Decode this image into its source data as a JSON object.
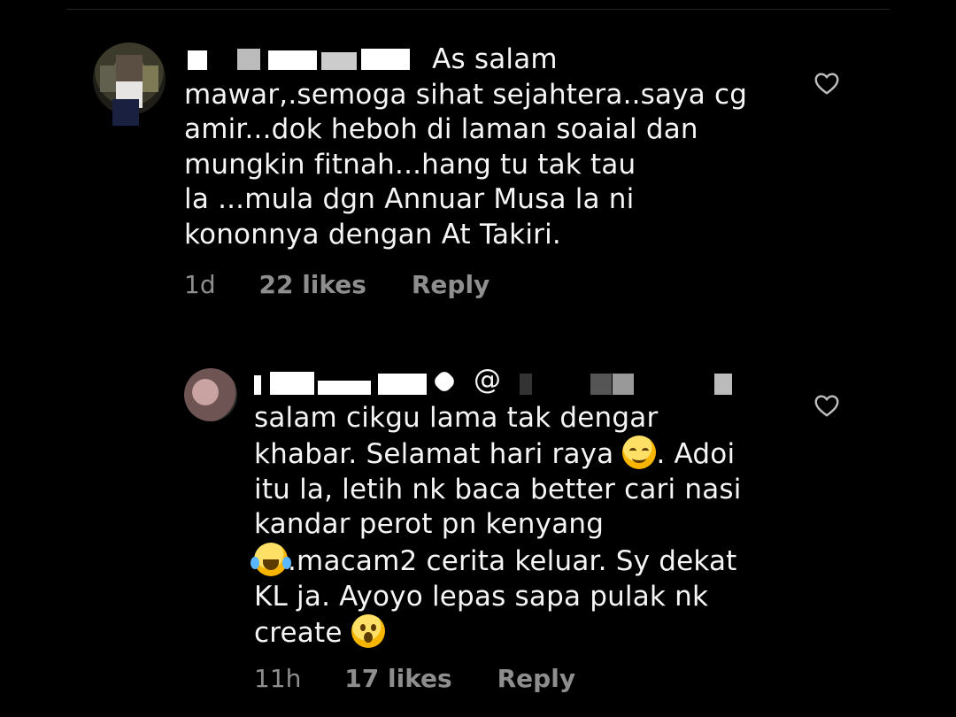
{
  "comments": [
    {
      "lines": [
        "As salam",
        "mawar,.semoga sihat sejahtera..saya cg",
        "amir...dok heboh di laman soaial dan",
        "mungkin fitnah...hang tu tak tau",
        "la ...mula dgn Annuar Musa la ni",
        "kononnya dengan At Takiri."
      ],
      "time": "1d",
      "likes": "22 likes",
      "reply": "Reply"
    },
    {
      "mention": "@",
      "lines": [
        "salam cikgu lama tak dengar",
        "khabar. Selamat hari raya",
        ". Adoi",
        "itu la, letih nk baca better cari nasi",
        "kandar perot pn kenyang",
        ".macam2 cerita keluar. Sy dekat",
        "KL ja. Ayoyo lepas sapa pulak nk",
        "create"
      ],
      "time": "11h",
      "likes": "17 likes",
      "reply": "Reply"
    }
  ],
  "icons": {
    "like": "heart-outline-icon",
    "verified": "verified-badge-icon",
    "emoji_1": "smiling-face-emoji",
    "emoji_2": "tears-of-joy-emoji",
    "emoji_3": "surprised-face-emoji"
  },
  "colors": {
    "background": "#000000",
    "text": "#f5f5f5",
    "meta": "#8e8e8e",
    "verified": "#3897f0"
  }
}
